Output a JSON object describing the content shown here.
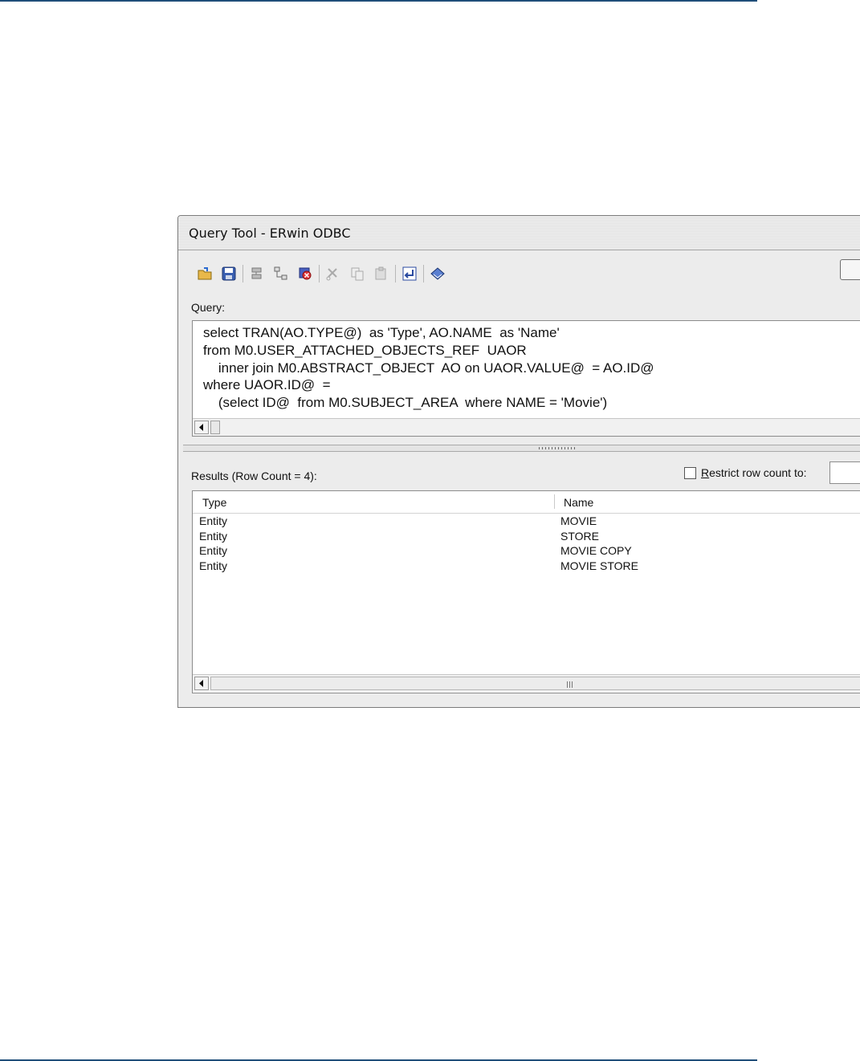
{
  "window": {
    "title": "Query Tool - ERwin ODBC"
  },
  "toolbar": {
    "buttons": [
      {
        "icon": "open-folder-icon"
      },
      {
        "icon": "save-icon"
      },
      {
        "icon": "connect-icon"
      },
      {
        "icon": "network-icon"
      },
      {
        "icon": "disconnect-icon"
      },
      {
        "icon": "cut-icon"
      },
      {
        "icon": "copy-icon"
      },
      {
        "icon": "paste-icon"
      },
      {
        "icon": "execute-icon"
      },
      {
        "icon": "book-icon"
      }
    ]
  },
  "query": {
    "label": "Query:",
    "text": "select TRAN(AO.TYPE@)  as 'Type', AO.NAME  as 'Name'\nfrom M0.USER_ATTACHED_OBJECTS_REF  UAOR\n    inner join M0.ABSTRACT_OBJECT  AO on UAOR.VALUE@  = AO.ID@\nwhere UAOR.ID@  =\n    (select ID@  from M0.SUBJECT_AREA  where NAME = 'Movie')"
  },
  "results": {
    "label": "Results (Row Count = 4):",
    "restrict_prefix": "R",
    "restrict_rest": "estrict row count to:",
    "columns": [
      "Type",
      "Name"
    ],
    "rows": [
      [
        "Entity",
        "MOVIE"
      ],
      [
        "Entity",
        "STORE"
      ],
      [
        "Entity",
        "MOVIE COPY"
      ],
      [
        "Entity",
        "MOVIE STORE"
      ]
    ]
  },
  "colors": {
    "page_rule": "#1f4e79",
    "window_bg": "#ececec"
  }
}
